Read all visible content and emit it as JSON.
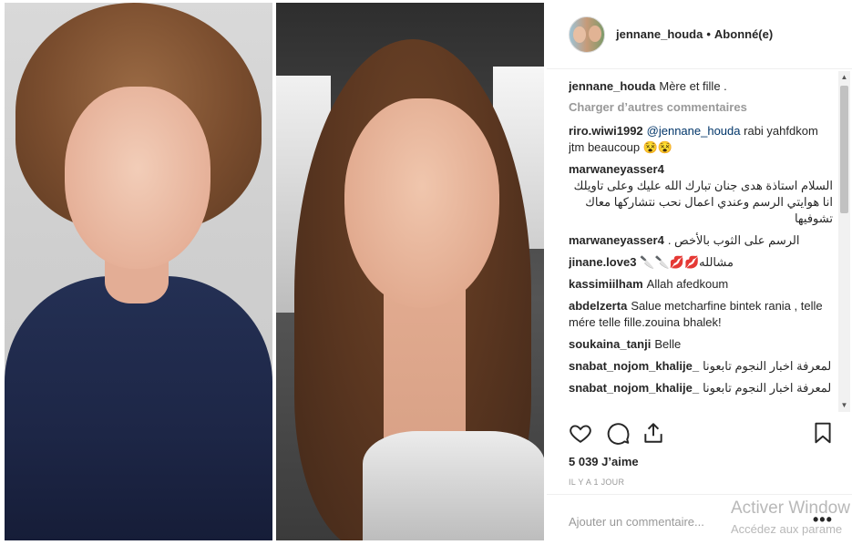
{
  "post": {
    "username": "jennane_houda",
    "separator": "•",
    "follow_status": "Abonné(e)",
    "caption": {
      "user": "jennane_houda",
      "text": "Mère et fille ."
    },
    "load_more": "Charger d’autres commentaires",
    "comments": [
      {
        "user": "riro.wiwi1992",
        "mention": "@jennane_houda",
        "text": "rabi yahfdkom jtm beaucoup 😵😵",
        "rtl": false
      },
      {
        "user": "marwaneyasser4",
        "text": "السلام استاذة هدى جنان تبارك الله عليك وعلى تاويلك انا هوايتي الرسم وعندي اعمال نحب نتشاركها معاك تشوفيها",
        "rtl": true
      },
      {
        "user": "marwaneyasser4",
        "text": "الرسم على الثوب بالأخص .",
        "rtl": true
      },
      {
        "user": "jinane.love3",
        "text": "مشالله💋💋🔪🔪",
        "rtl": true
      },
      {
        "user": "kassimiilham",
        "text": "Allah afedkoum",
        "rtl": false
      },
      {
        "user": "abdelzerta",
        "text": "Salue metcharfine bintek rania , telle mére telle fille.zouina bhalek!",
        "rtl": false
      },
      {
        "user": "soukaina_tanji",
        "text": "Belle",
        "rtl": false
      },
      {
        "user": "snabat_nojom_khalije_",
        "text": "لمعرفة اخبار النجوم تابعونا",
        "rtl": true
      },
      {
        "user": "snabat_nojom_khalije_",
        "text": "لمعرفة اخبار النجوم تابعونا",
        "rtl": true
      }
    ],
    "likes": "5 039 J’aime",
    "timestamp": "IL Y A 1 JOUR",
    "add_comment_placeholder": "Ajouter un commentaire...",
    "more_options": "•••"
  },
  "os_watermark": {
    "title": "Activer Window",
    "subtitle": "Accédez aux parame"
  },
  "icons": {
    "like": "heart-icon",
    "comment": "speech-bubble-icon",
    "share": "share-icon",
    "save": "bookmark-icon"
  },
  "colors": {
    "text": "#262626",
    "muted": "#999999",
    "mention": "#003569",
    "border": "#efefef"
  }
}
